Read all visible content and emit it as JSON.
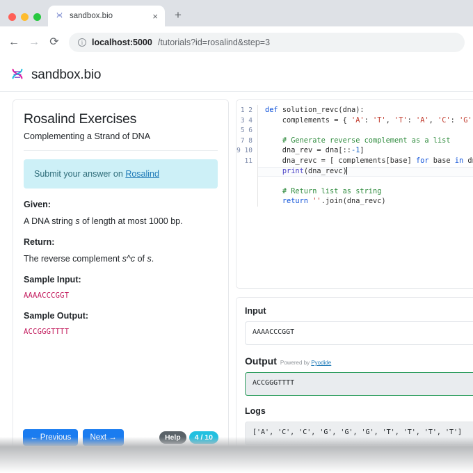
{
  "browser": {
    "tab": {
      "title": "sandbox.bio",
      "favicon": "dna-icon",
      "close": "×"
    },
    "new_tab": "+",
    "nav": {
      "back": "←",
      "forward": "→",
      "reload": "⟳"
    },
    "omnibox": {
      "host": "localhost:5000",
      "path": "/tutorials?id=rosalind&step=3"
    }
  },
  "site": {
    "logo": "dna-icon",
    "brand": "sandbox.bio"
  },
  "exercise": {
    "title": "Rosalind Exercises",
    "subtitle": "Complementing a Strand of DNA",
    "info_prefix": "Submit your answer on ",
    "info_link": "Rosalind",
    "given_label": "Given:",
    "given_text_a": "A DNA string ",
    "given_text_i": "s",
    "given_text_b": " of length at most 1000 bp.",
    "return_label": "Return:",
    "return_text_a": "The reverse complement ",
    "return_text_i": "s^c",
    "return_text_b": " of ",
    "return_text_i2": "s",
    "return_text_c": ".",
    "sample_input_label": "Sample Input:",
    "sample_input": "AAAACCCGGT",
    "sample_output_label": "Sample Output:",
    "sample_output": "ACCGGGTTTT"
  },
  "footer": {
    "previous": "← Previous",
    "next": "Next →",
    "help": "Help",
    "step": "4 / 10"
  },
  "editor": {
    "line_numbers": "1\n2\n3\n4\n5\n6\n7\n8\n9\n10\n11",
    "lines": [
      "def solution_revc(dna):",
      "    complements = { 'A': 'T', 'T': 'A', 'C': 'G', 'G': 'C' }",
      "",
      "    # Generate reverse complement as a list",
      "    dna_rev = dna[::-1]",
      "    dna_revc = [ complements[base] for base in dna_rev ]",
      "    print(dna_revc)",
      "",
      "    # Return list as string",
      "    return ''.join(dna_revc)",
      ""
    ]
  },
  "io": {
    "input_label": "Input",
    "input_value": "AAAACCCGGT",
    "output_label": "Output",
    "output_powered": "Powered by ",
    "output_powered_link": "Pyodide",
    "output_value": "ACCGGGTTTT",
    "logs_label": "Logs",
    "logs_value": "['A', 'C', 'C', 'G', 'G', 'G', 'T', 'T', 'T', 'T']"
  },
  "colors": {
    "accent_blue": "#1a7cf0",
    "badge_cyan": "#22c0e0",
    "badge_gray": "#5a6268",
    "info_box": "#cdf0f7",
    "sequence_pink": "#c2185b",
    "output_border_green": "#2f9e5f"
  }
}
